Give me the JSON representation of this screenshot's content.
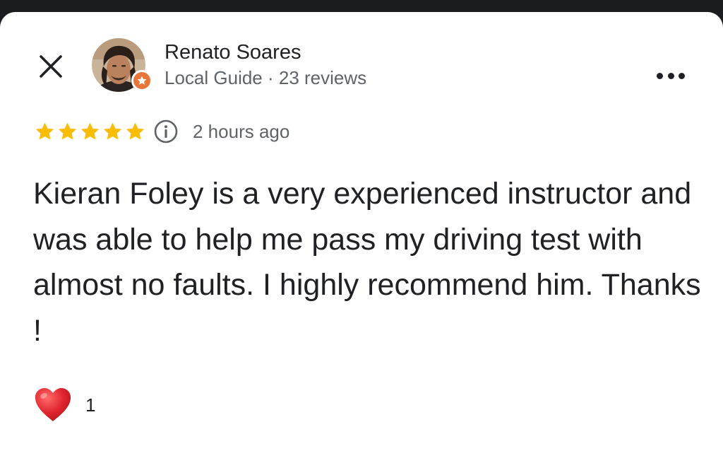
{
  "header": {
    "close_icon": "close-icon",
    "more_icon": "more-options-icon"
  },
  "author": {
    "name": "Renato Soares",
    "meta": "Local Guide · 23 reviews",
    "badge_color": "#e8763a",
    "avatar_icon": "user-avatar"
  },
  "review": {
    "rating": 5,
    "max_rating": 5,
    "star_color": "#fbbc04",
    "time_ago": "2 hours ago",
    "text": "Kieran Foley is a very experienced instructor and was able to help me pass my driving test with almost no faults. I highly recommend him. Thanks !"
  },
  "reactions": {
    "icon": "red-heart-icon",
    "heart_color": "#e0262f",
    "count": "1"
  }
}
